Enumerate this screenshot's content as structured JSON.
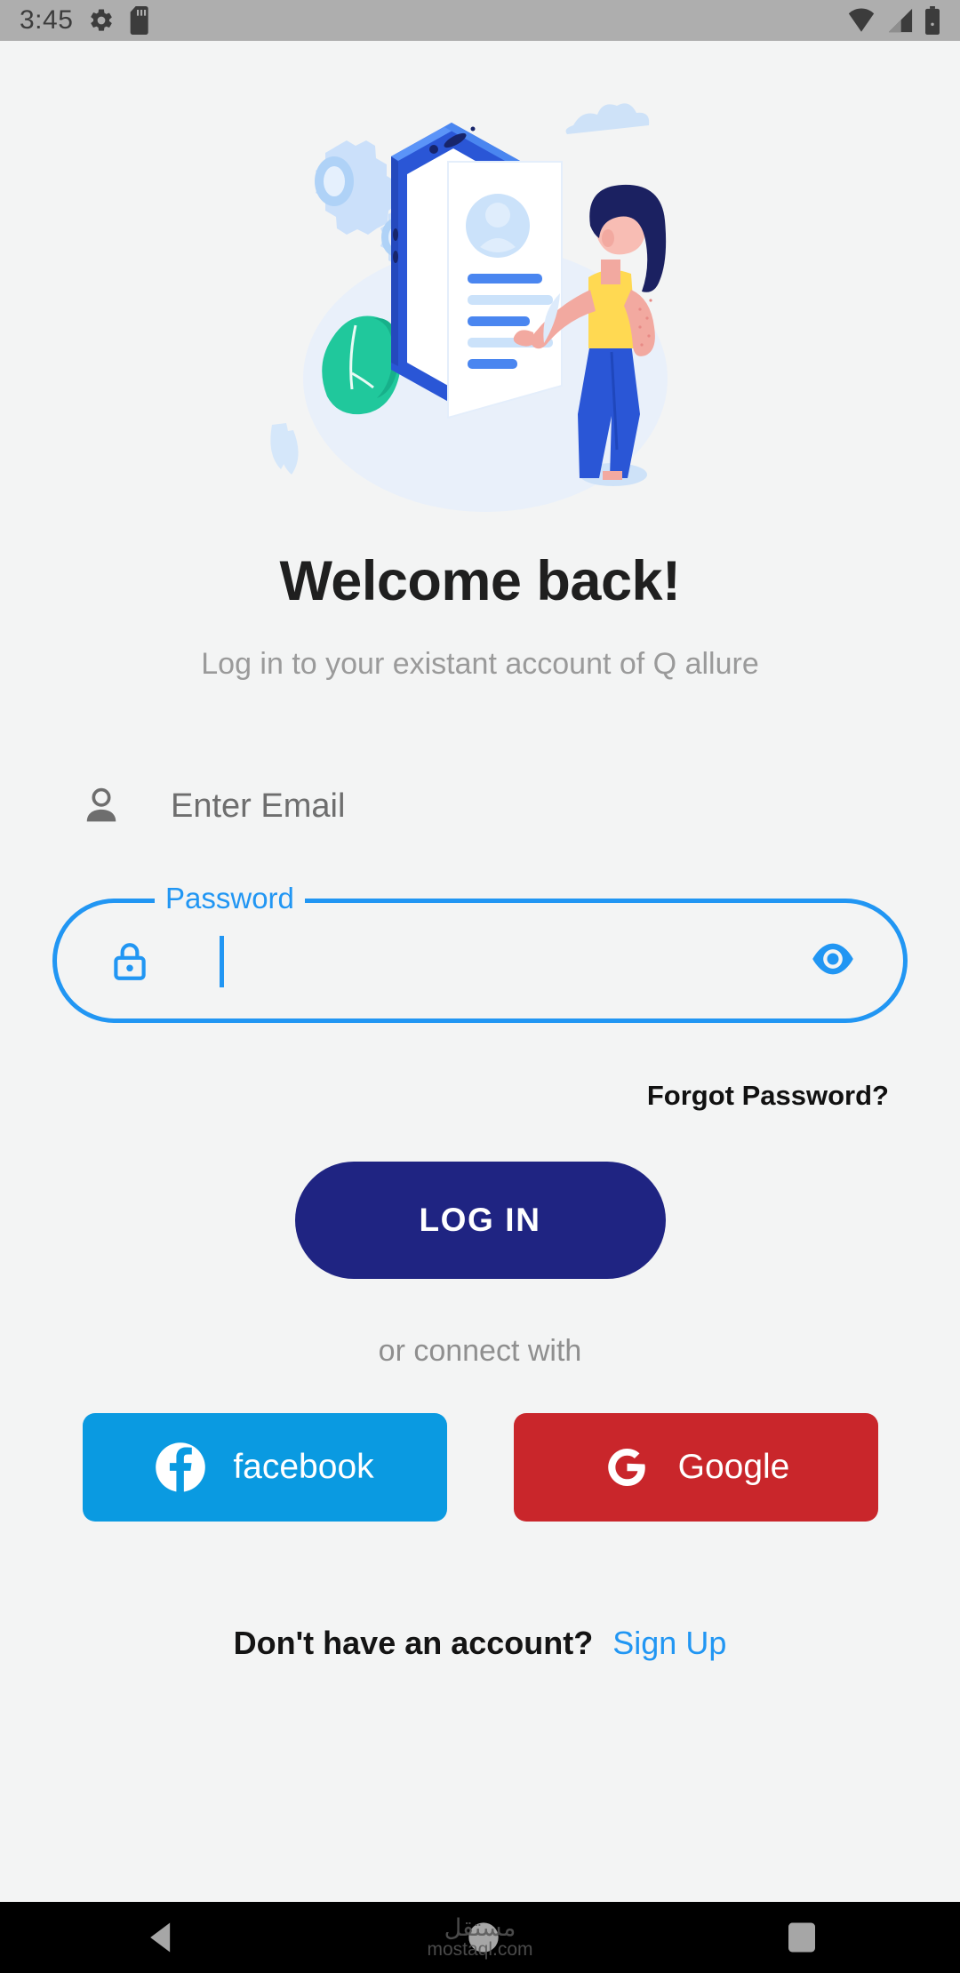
{
  "status_bar": {
    "time": "3:45",
    "left_icons": [
      "gear-icon",
      "sd-card-icon"
    ],
    "right_icons": [
      "wifi-icon",
      "cellular-signal-icon",
      "battery-icon"
    ],
    "background": "#AEAEAE"
  },
  "hero": {
    "illustration_name": "login-illustration",
    "elements": [
      "gears",
      "smartphone",
      "profile-card",
      "cactus",
      "woman",
      "cloud",
      "leaf"
    ],
    "colors": {
      "phone_blue": "#2A56D6",
      "phone_light": "#4A8BF5",
      "gear_blue": "#CFE2FA",
      "cactus_green": "#21C99A",
      "hair_navy": "#1B2161",
      "top_yellow": "#FFD952",
      "jeans_blue": "#2A56D6",
      "skin": "#F2A9A0",
      "ellipse_bg": "#EBF1FA"
    }
  },
  "header": {
    "title": "Welcome back!",
    "subtitle": "Log in to your existant account of Q allure"
  },
  "form": {
    "email": {
      "icon": "person-icon",
      "placeholder": "Enter Email",
      "value": ""
    },
    "password": {
      "icon": "lock-icon",
      "label": "Password",
      "value": "",
      "focused": true,
      "toggle_icon": "eye-icon",
      "accent_color": "#2196F3"
    },
    "forgot_password_label": "Forgot Password?"
  },
  "actions": {
    "login_label": "LOG IN",
    "login_color": "#1F2482",
    "or_connect_label": "or connect with",
    "social": [
      {
        "name": "facebook",
        "label": "facebook",
        "icon": "facebook-icon",
        "color": "#0A9AE1"
      },
      {
        "name": "google",
        "label": "Google",
        "icon": "google-icon",
        "color": "#C9262B"
      }
    ]
  },
  "footer": {
    "signup_question": "Don't have an account?",
    "signup_link": "Sign Up",
    "signup_link_color": "#2196F3"
  },
  "nav_bar": {
    "back_label": "back-button",
    "home_label": "home-button",
    "recents_label": "recents-button",
    "watermark_ar": "مستقل",
    "watermark_en": "mostaql.com"
  }
}
